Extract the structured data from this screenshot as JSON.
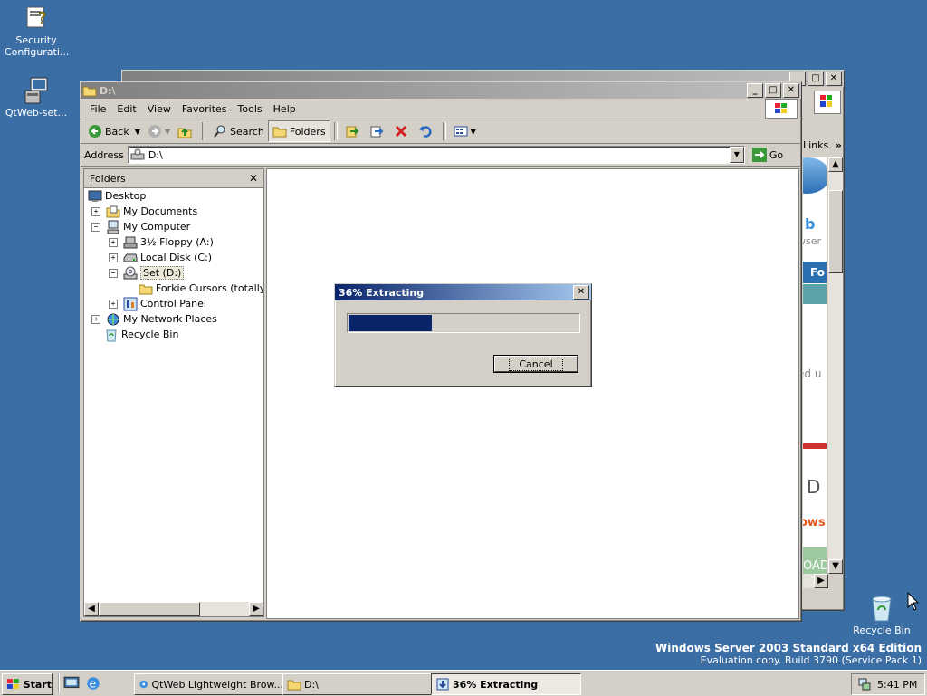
{
  "desktop": {
    "icons": [
      {
        "label": "Security Configurati...",
        "icon": "security-config-icon"
      },
      {
        "label": "QtWeb-set...",
        "icon": "installer-icon"
      },
      {
        "label": "Recycle Bin",
        "icon": "recycle-bin-icon"
      }
    ],
    "edition_line1": "Windows Server 2003 Standard x64 Edition",
    "edition_line2": "Evaluation copy. Build 3790 (Service Pack 1)"
  },
  "explorer": {
    "title": "D:\\",
    "menu": [
      "File",
      "Edit",
      "View",
      "Favorites",
      "Tools",
      "Help"
    ],
    "toolbar": {
      "back": "Back",
      "search": "Search",
      "folders": "Folders"
    },
    "address_label": "Address",
    "address_value": "D:\\",
    "go_label": "Go",
    "folders_pane_title": "Folders",
    "tree": [
      {
        "label": "Desktop",
        "expander": "",
        "level": 0
      },
      {
        "label": "My Documents",
        "expander": "+",
        "level": 1
      },
      {
        "label": "My Computer",
        "expander": "-",
        "level": 1
      },
      {
        "label": "3½ Floppy (A:)",
        "expander": "+",
        "level": 2
      },
      {
        "label": "Local Disk (C:)",
        "expander": "+",
        "level": 2
      },
      {
        "label": "Set (D:)",
        "expander": "-",
        "level": 2
      },
      {
        "label": "Forkie Cursors (totally n",
        "expander": "",
        "level": 3
      },
      {
        "label": "Control Panel",
        "expander": "+",
        "level": 2
      },
      {
        "label": "My Network Places",
        "expander": "+",
        "level": 1
      },
      {
        "label": "Recycle Bin",
        "expander": "",
        "level": 1
      }
    ]
  },
  "background_browser": {
    "links_label": "Links",
    "snippets": [
      "b",
      "wser",
      "Fo",
      "ed u",
      "D",
      "ows",
      "OAD"
    ]
  },
  "dialog": {
    "title": "36% Extracting",
    "progress": 0.36,
    "cancel_label": "Cancel"
  },
  "taskbar": {
    "start_label": "Start",
    "tasks": [
      "QtWeb Lightweight Brow...",
      "D:\\",
      "36% Extracting"
    ],
    "clock": "5:41 PM"
  },
  "colors": {
    "desktop": "#3a6ea5",
    "title_active": "#0a246a",
    "progress": "#0a246a"
  }
}
